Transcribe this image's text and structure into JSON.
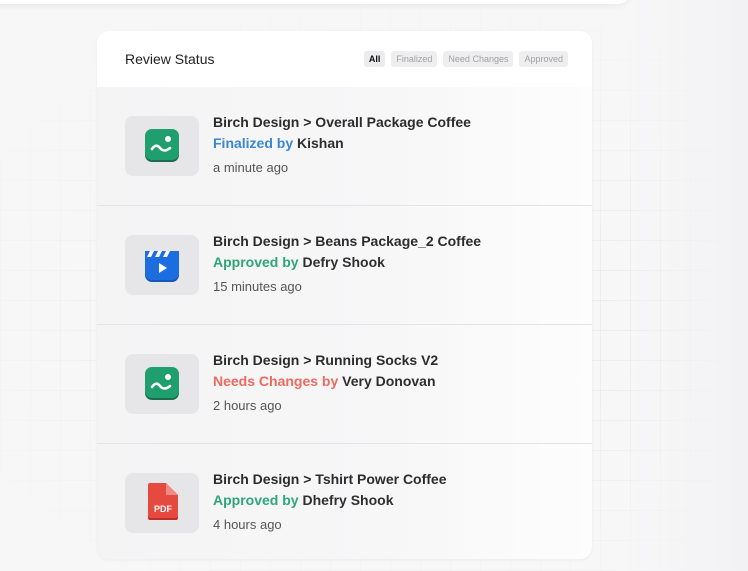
{
  "panel": {
    "title": "Review Status",
    "filters": [
      "All",
      "Finalized",
      "Need Changes",
      "Approved"
    ],
    "active_filter": "All"
  },
  "items": [
    {
      "icon": "image-file-icon",
      "path": "Birch Design > Overall Package Coffee",
      "status_label": "Finalized by",
      "status_color": "#3a86d4",
      "user": "Kishan",
      "time": "a minute ago"
    },
    {
      "icon": "video-file-icon",
      "path": "Birch Design > Beans Package_2 Coffee",
      "status_label": "Approved by",
      "status_color": "#2fa57a",
      "user": "Defry Shook",
      "time": "15 minutes ago"
    },
    {
      "icon": "image-file-icon",
      "path": "Birch Design > Running Socks V2",
      "status_label": "Needs Changes by",
      "status_color": "#ee6a5f",
      "user": "Very Donovan",
      "time": "2 hours ago"
    },
    {
      "icon": "pdf-file-icon",
      "path": "Birch Design > Tshirt Power Coffee",
      "status_label": "Approved by",
      "status_color": "#2fa57a",
      "user": "Dhefry Shook",
      "time": "4 hours ago",
      "icon_text": "PDF"
    }
  ]
}
